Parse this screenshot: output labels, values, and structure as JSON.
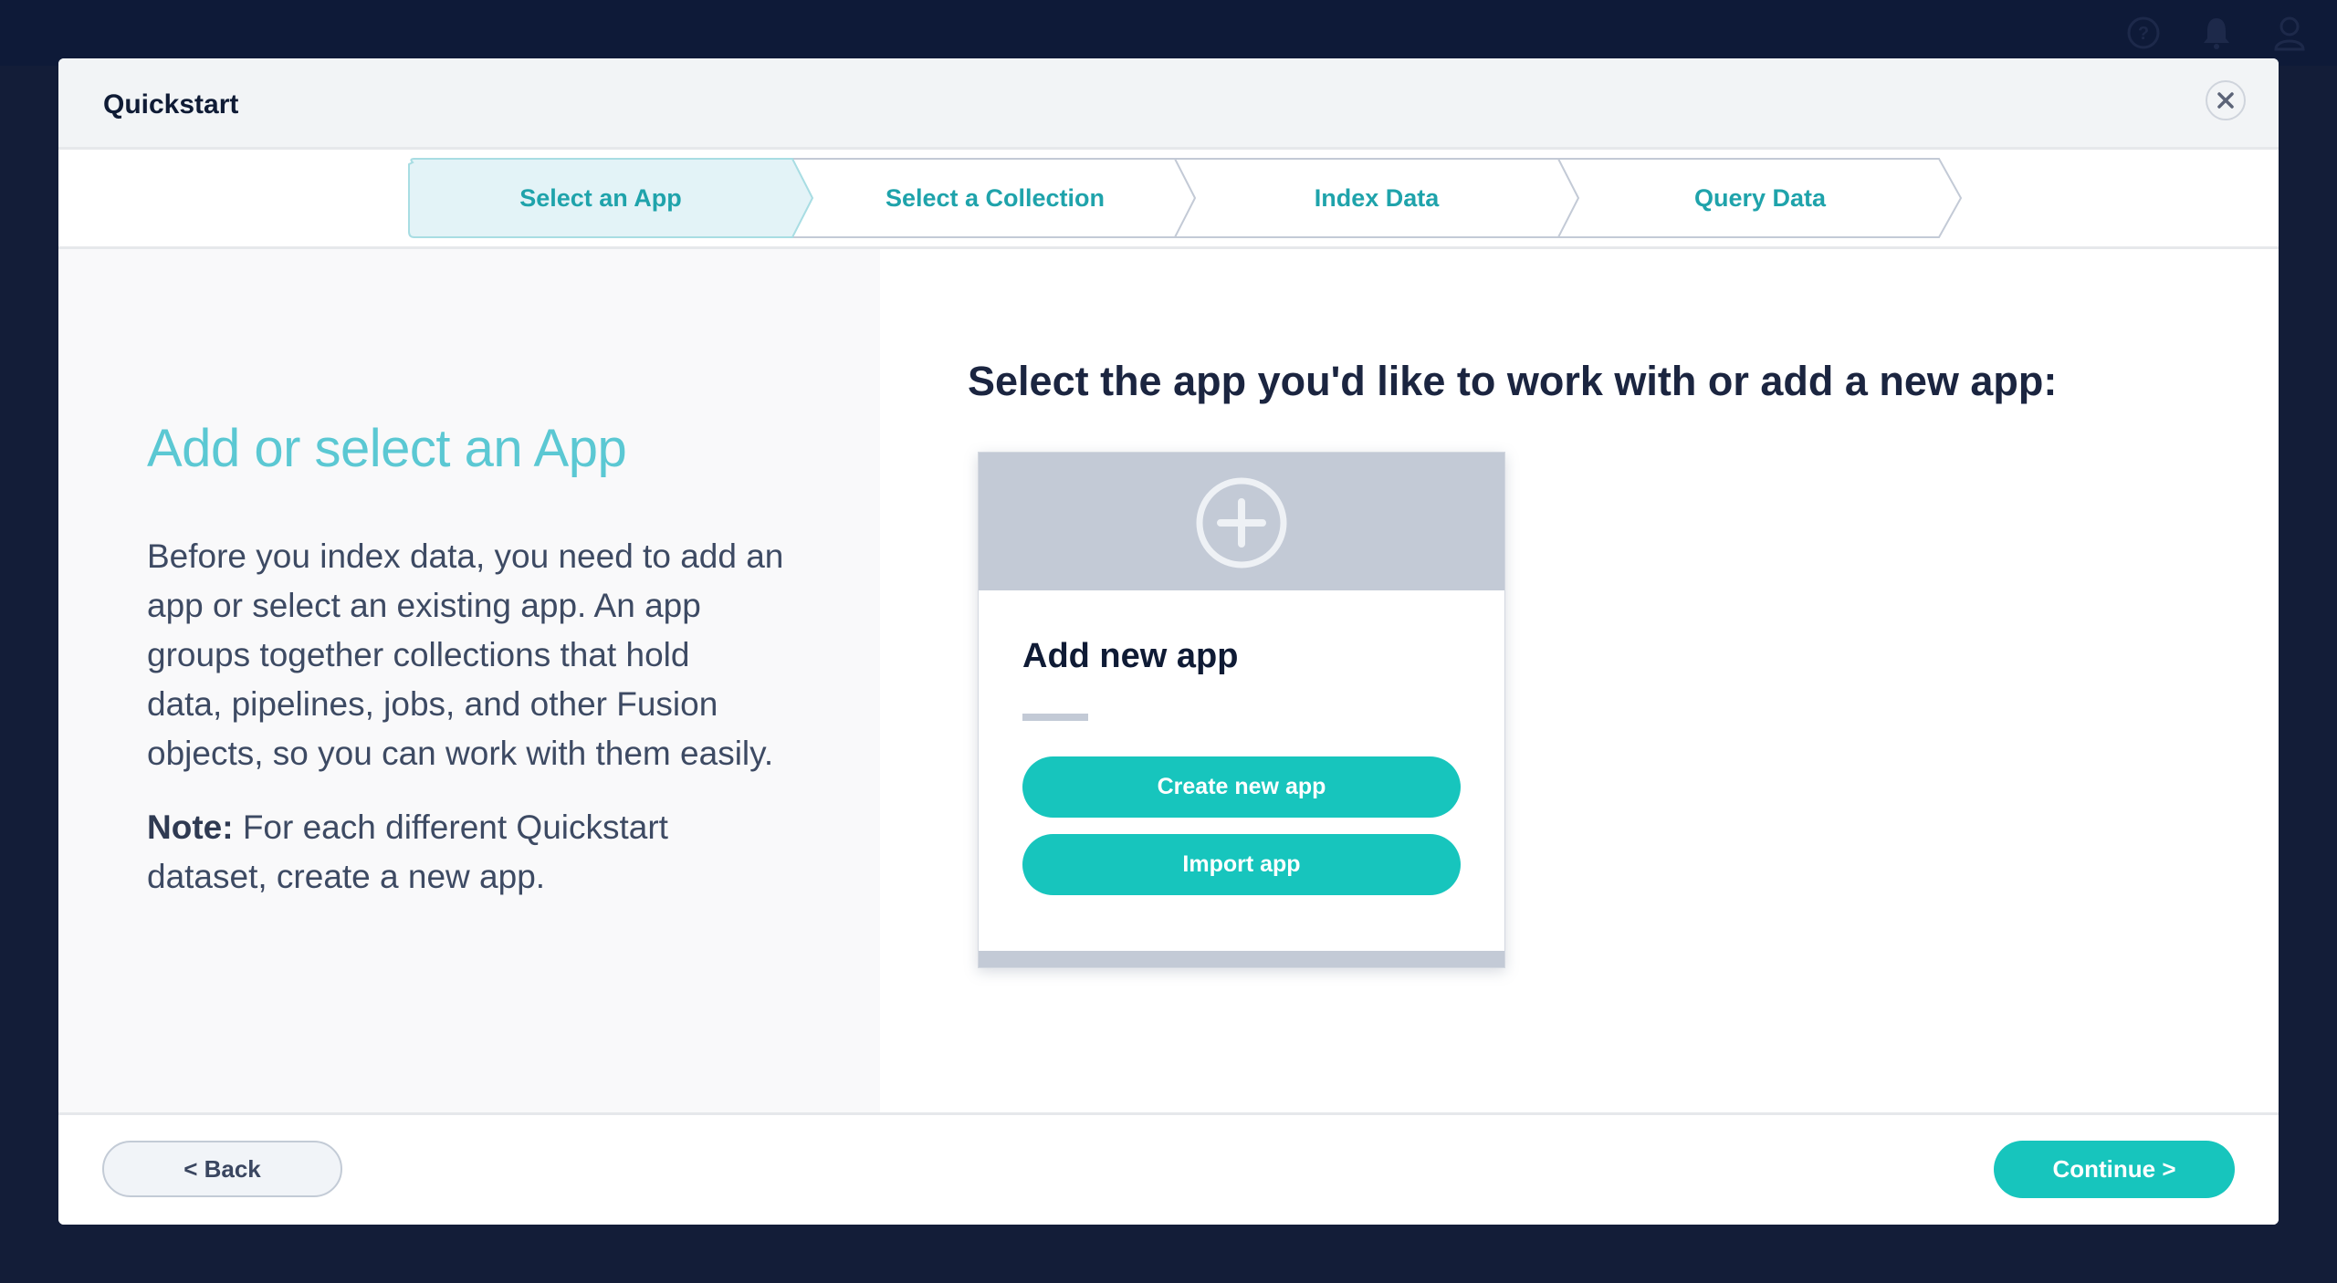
{
  "topbar": {
    "icons": [
      "help-icon",
      "bell-icon",
      "user-icon"
    ]
  },
  "modal": {
    "title": "Quickstart",
    "close_icon": "close-icon"
  },
  "steps": [
    {
      "label": "Select an App",
      "active": true
    },
    {
      "label": "Select a Collection",
      "active": false
    },
    {
      "label": "Index Data",
      "active": false
    },
    {
      "label": "Query Data",
      "active": false
    }
  ],
  "left_panel": {
    "heading": "Add or select an App",
    "body_lines": [
      "Before you index data, you need to add an",
      "app or select an existing app. An app",
      "groups together collections that hold",
      "data, pipelines, jobs, and other Fusion",
      "objects, so you can work with them easily."
    ],
    "note_label": "Note:",
    "note_lines": [
      " For each different Quickstart",
      "dataset, create a new app."
    ]
  },
  "right_panel": {
    "title": "Select the app you'd like to work with or add a new app:",
    "card": {
      "icon": "plus-circle-icon",
      "title": "Add new app",
      "create_label": "Create new app",
      "import_label": "Import app"
    }
  },
  "footer": {
    "back_label": "< Back",
    "continue_label": "Continue >"
  },
  "colors": {
    "accent": "#17c5bd",
    "step_text": "#1fa3ab",
    "heading": "#5bc8d3",
    "navy": "#0e1a38"
  }
}
